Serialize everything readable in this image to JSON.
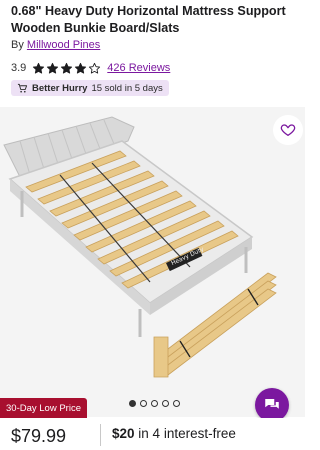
{
  "product": {
    "title": "0.68\" Heavy Duty Horizontal Mattress Support Wooden Bunkie Board/Slats",
    "by_prefix": "By",
    "brand": "Millwood Pines",
    "rating": "3.9",
    "stars_filled": 4,
    "stars_total": 5,
    "reviews": "426 Reviews",
    "badge": {
      "icon": "cart-icon",
      "strong": "Better Hurry",
      "text": "15 sold in 5 days"
    },
    "image_label": "Heavy Duty",
    "low_price_tag": "30-Day Low Price",
    "carousel": {
      "count": 5,
      "active": 0
    },
    "price": "$79.99",
    "installment": {
      "amount": "$20",
      "text": "in 4 interest-free"
    }
  },
  "colors": {
    "accent": "#7b189f",
    "badge_bg": "#ede1f5",
    "sale_red": "#a80f2f",
    "wood": "#e6c27f"
  },
  "icons": {
    "favorite": "heart-icon",
    "chat": "chat-icon",
    "star": "star-icon"
  }
}
